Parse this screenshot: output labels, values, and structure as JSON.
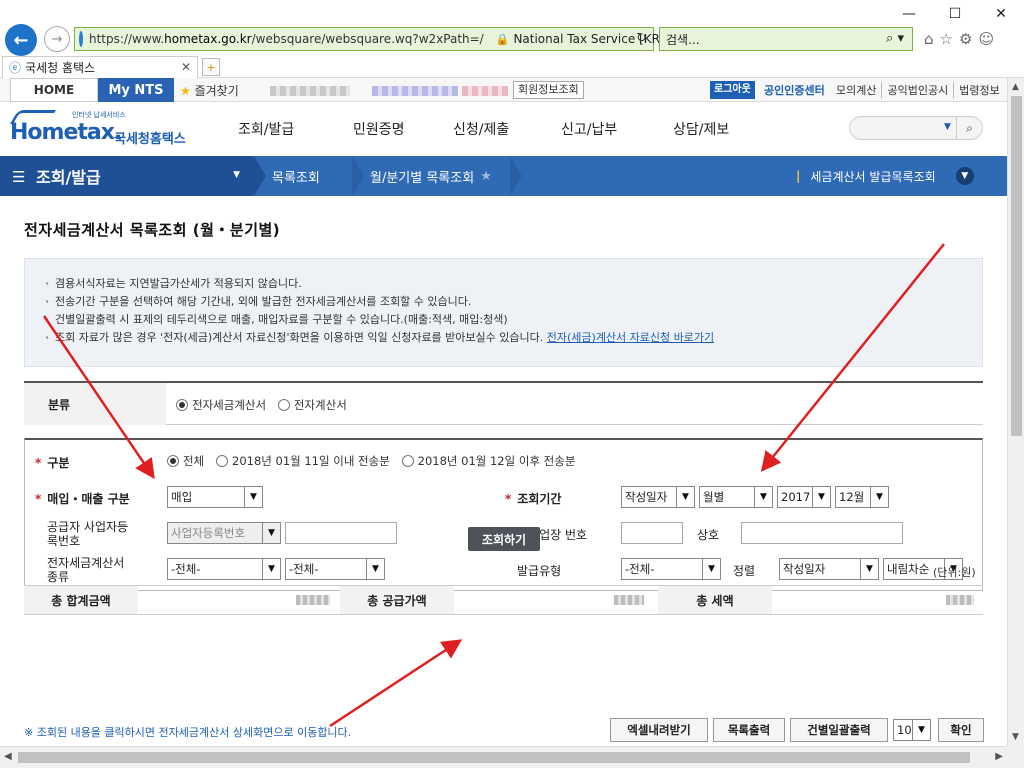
{
  "window": {
    "minimize": "—",
    "maximize": "☐",
    "close": "✕"
  },
  "addressbar": {
    "url_prefix": "https://www.",
    "url_domain": "hometax.go.kr",
    "url_path": "/websquare/websquare.wq?w2xPath=/",
    "site_identity": "National Tax Service [KR]",
    "search_placeholder": "검색..."
  },
  "tab": {
    "title": "국세청 홈택스"
  },
  "topbar": {
    "home": "HOME",
    "mynts": "My NTS",
    "favorites": "즐겨찾기",
    "member_info": "회원정보조회",
    "logout": "로그아웃",
    "cert_center": "공인인증센터",
    "links": [
      "모의계산",
      "공익법인공시",
      "법령정보"
    ]
  },
  "header": {
    "logo_text": "Hometax.",
    "logo_tagline": "인터넷 납세서비스",
    "logo_korean": "국세청홈택스",
    "gnb": [
      "조회/발급",
      "민원증명",
      "신청/제출",
      "신고/납부",
      "상담/제보"
    ]
  },
  "locnav": {
    "menu": "조회/발급",
    "step2": "목록조회",
    "step3": "월/분기별 목록조회",
    "current_marker": "|",
    "current_title": "세금계산서 발급목록조회"
  },
  "page_title": "전자세금계산서 목록조회 (월・분기별)",
  "notices": [
    "겸용서식자료는 지연발급가산세가 적용되지 않습니다.",
    "전송기간 구분을 선택하여 해당 기간내, 외에 발급한 전자세금계산서를 조회할 수 있습니다.",
    "건별일괄출력 시 표제의 테두리색으로 매출, 매입자료를 구분할 수 있습니다.(매출:적색, 매입:청색)",
    "조회 자료가 많은 경우 '전자(세금)계산서 자료신청'화면을 이용하면 익일 신청자료를 받아보실수 있습니다."
  ],
  "notice_link": "전자(세금)계산서 자료신청 바로가기",
  "category": {
    "label": "분류",
    "options": [
      "전자세금계산서",
      "전자계산서"
    ],
    "selected": 0
  },
  "filter": {
    "required_mark": "*",
    "division_label": "구분",
    "division_options": [
      "전체",
      "2018년 01월 11일 이내 전송분",
      "2018년 01월 12일 이후 전송분"
    ],
    "division_selected": 0,
    "trade_label": "매입・매출 구분",
    "trade_value": "매입",
    "period_label": "조회기간",
    "period_basis": "작성일자",
    "period_unit": "월별",
    "period_year": "2017",
    "period_month": "12월",
    "supplier_label_1": "공급자 사업자등",
    "supplier_label_2": "록번호",
    "supplier_type": "사업자등록번호",
    "branch_label": "종사업장 번호",
    "company_label": "상호",
    "invoice_type_label_1": "전자세금계산서",
    "invoice_type_label_2": "종류",
    "invoice_type_1": "-전체-",
    "invoice_type_2": "-전체-",
    "issue_type_label": "발급유형",
    "issue_type": "-전체-",
    "sort_label": "정렬",
    "sort_field": "작성일자",
    "sort_order": "내림차순"
  },
  "search_button": "조회하기",
  "unit": "(단위:원)",
  "summary": {
    "total_label": "총 합계금액",
    "supply_label": "총 공급가액",
    "tax_label": "총 세액"
  },
  "hint": "※ 조회된 내용을 클릭하시면 전자세금계산서 상세화면으로 이동합니다.",
  "actions": {
    "excel": "엑셀내려받기",
    "print_list": "목록출력",
    "print_each": "건별일괄출력",
    "page_size": "10",
    "confirm": "확인"
  },
  "colors": {
    "brand_blue": "#1d5fb5",
    "nav_blue": "#2f6ab5",
    "annotation_red": "#e02020",
    "required_red": "#c62828"
  }
}
